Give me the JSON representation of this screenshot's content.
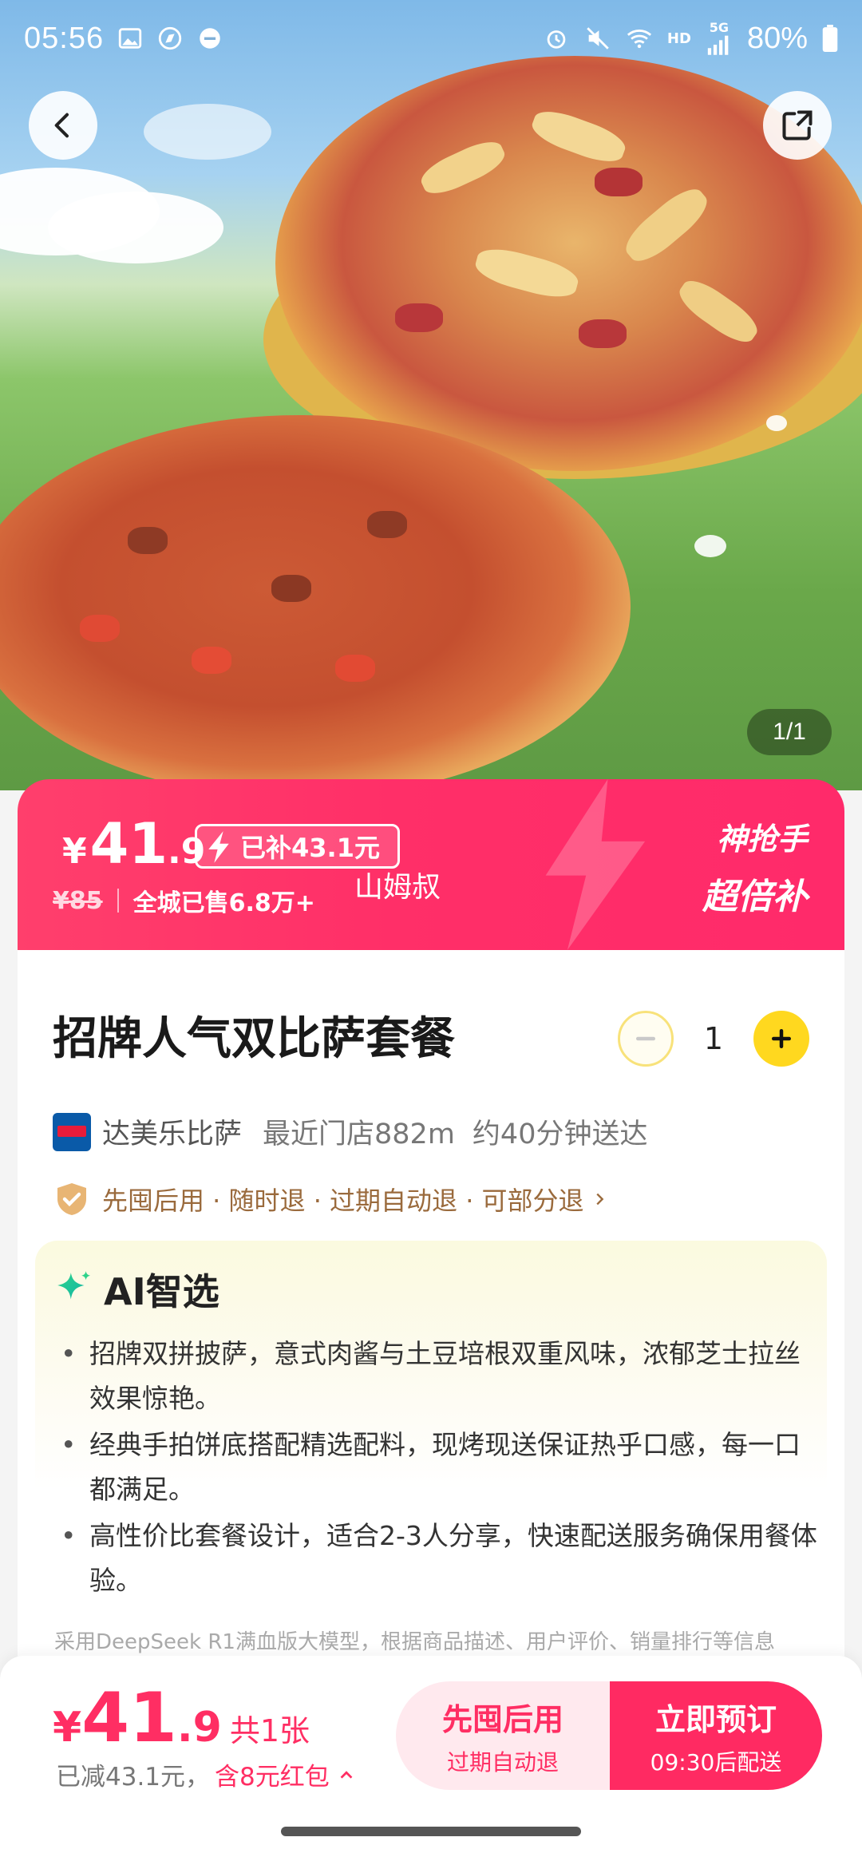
{
  "status_bar": {
    "time": "05:56",
    "battery": "80%",
    "network": "5G",
    "hd": "HD"
  },
  "gallery": {
    "counter": "1/1"
  },
  "price_banner": {
    "currency": "¥",
    "price_int": "41",
    "price_dec": ".9",
    "subsidy": "已补43.1元",
    "original_price": "¥85",
    "sold": "全城已售6.8万+",
    "promo_line1": "神抢手",
    "promo_line2": "超倍补"
  },
  "overlay_text": "山姆叔",
  "product": {
    "title": "招牌人气双比萨套餐",
    "quantity": "1"
  },
  "shop": {
    "name": "达美乐比萨",
    "distance": "最近门店882m",
    "delivery": "约40分钟送达"
  },
  "guarantee": "先囤后用 · 随时退 · 过期自动退 · 可部分退",
  "ai": {
    "title": "AI智选",
    "points": [
      "招牌双拼披萨，意式肉酱与土豆培根双重风味，浓郁芝士拉丝效果惊艳。",
      "经典手拍饼底搭配精选配料，现烤现送保证热乎口感，每一口都满足。",
      "高性价比套餐设计，适合2-3人分享，快速配送服务确保用餐体验。"
    ],
    "note": "采用DeepSeek R1满血版大模型，根据商品描述、用户评价、销量排行等信息"
  },
  "bottom": {
    "currency": "¥",
    "price_int": "41",
    "price_dec": ".9",
    "qty": "共1张",
    "reduced": "已减43.1元，",
    "redpacket": "含8元红包",
    "btn_left_main": "先囤后用",
    "btn_left_sub": "过期自动退",
    "btn_right_main": "立即预订",
    "btn_right_sub": "09:30后配送"
  },
  "colors": {
    "accent": "#ff2e63",
    "yellow": "#ffd81f",
    "banner_pink": "#ff3f6c"
  }
}
